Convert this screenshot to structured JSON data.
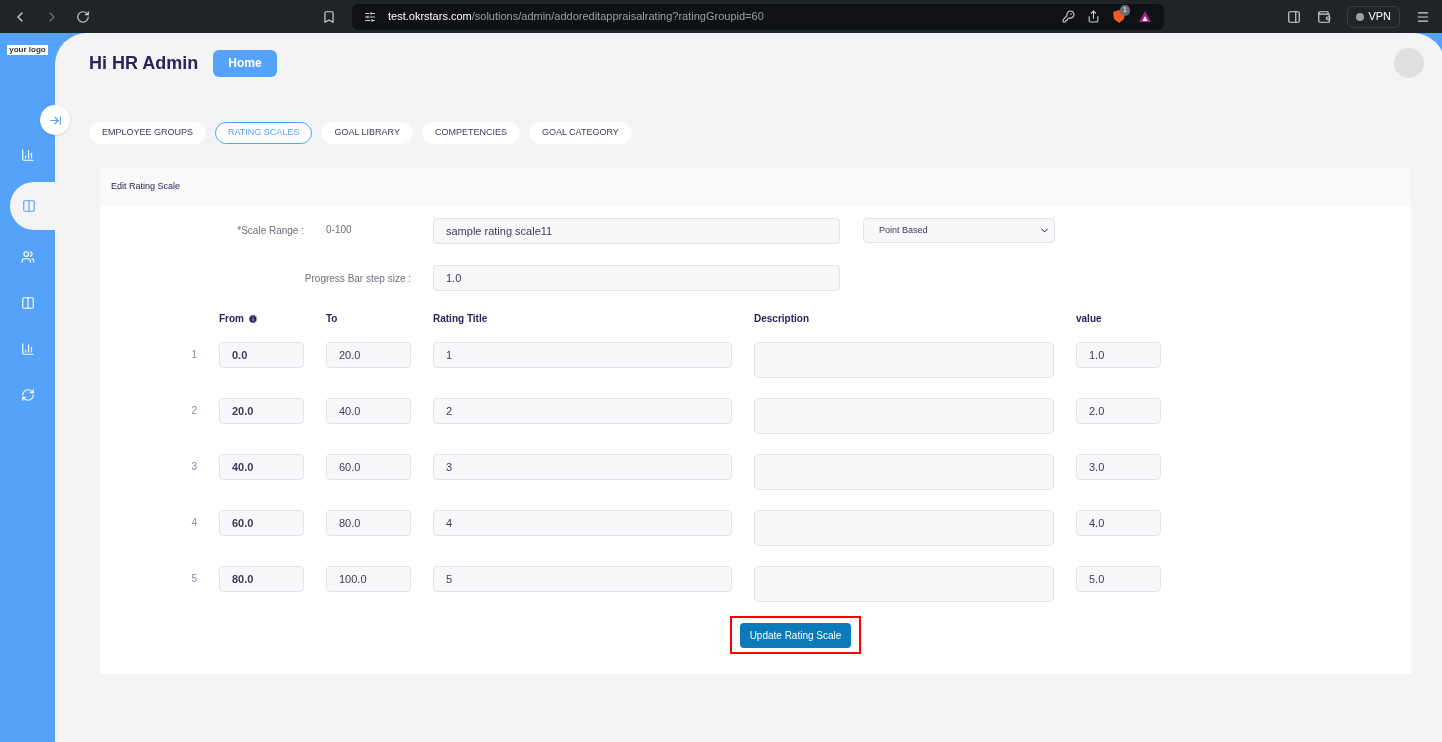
{
  "browser": {
    "url_host": "test.okrstars.com",
    "url_path": "/solutions/admin/addoreditappraisalrating?ratingGroupid=60",
    "shield_badge": "1",
    "vpn_label": "VPN"
  },
  "sidebar": {
    "logo": "your logo",
    "items": [
      {
        "kind": "chart",
        "selected": false
      },
      {
        "kind": "columns",
        "selected": true
      },
      {
        "kind": "people",
        "selected": false
      },
      {
        "kind": "columns",
        "selected": false
      },
      {
        "kind": "chart",
        "selected": false
      },
      {
        "kind": "degree",
        "selected": false
      }
    ]
  },
  "header": {
    "greeting": "Hi HR Admin",
    "home_button": "Home"
  },
  "tabs": [
    {
      "label": "EMPLOYEE GROUPS",
      "selected": false
    },
    {
      "label": "RATING SCALES",
      "selected": true
    },
    {
      "label": "GOAL LIBRARY",
      "selected": false
    },
    {
      "label": "COMPETENCIES",
      "selected": false
    },
    {
      "label": "GOAL CATEGORY",
      "selected": false
    }
  ],
  "form": {
    "title": "Edit Rating Scale",
    "scale_range_label": "*Scale Range :",
    "scale_range_value": "0-100",
    "scale_name": "sample rating scale11",
    "scale_type": "Point Based",
    "step_label": "Progress Bar step size :",
    "step_value": "1.0",
    "columns": [
      "From",
      "To",
      "Rating Title",
      "Description",
      "value"
    ],
    "rows": [
      {
        "index": "1",
        "from": "0.0",
        "to": "20.0",
        "title": "1",
        "value": "1.0"
      },
      {
        "index": "2",
        "from": "20.0",
        "to": "40.0",
        "title": "2",
        "value": "2.0"
      },
      {
        "index": "3",
        "from": "40.0",
        "to": "60.0",
        "title": "3",
        "value": "3.0"
      },
      {
        "index": "4",
        "from": "60.0",
        "to": "80.0",
        "title": "4",
        "value": "4.0"
      },
      {
        "index": "5",
        "from": "80.0",
        "to": "100.0",
        "title": "5",
        "value": "5.0"
      }
    ],
    "submit_button": "Update Rating Scale"
  }
}
